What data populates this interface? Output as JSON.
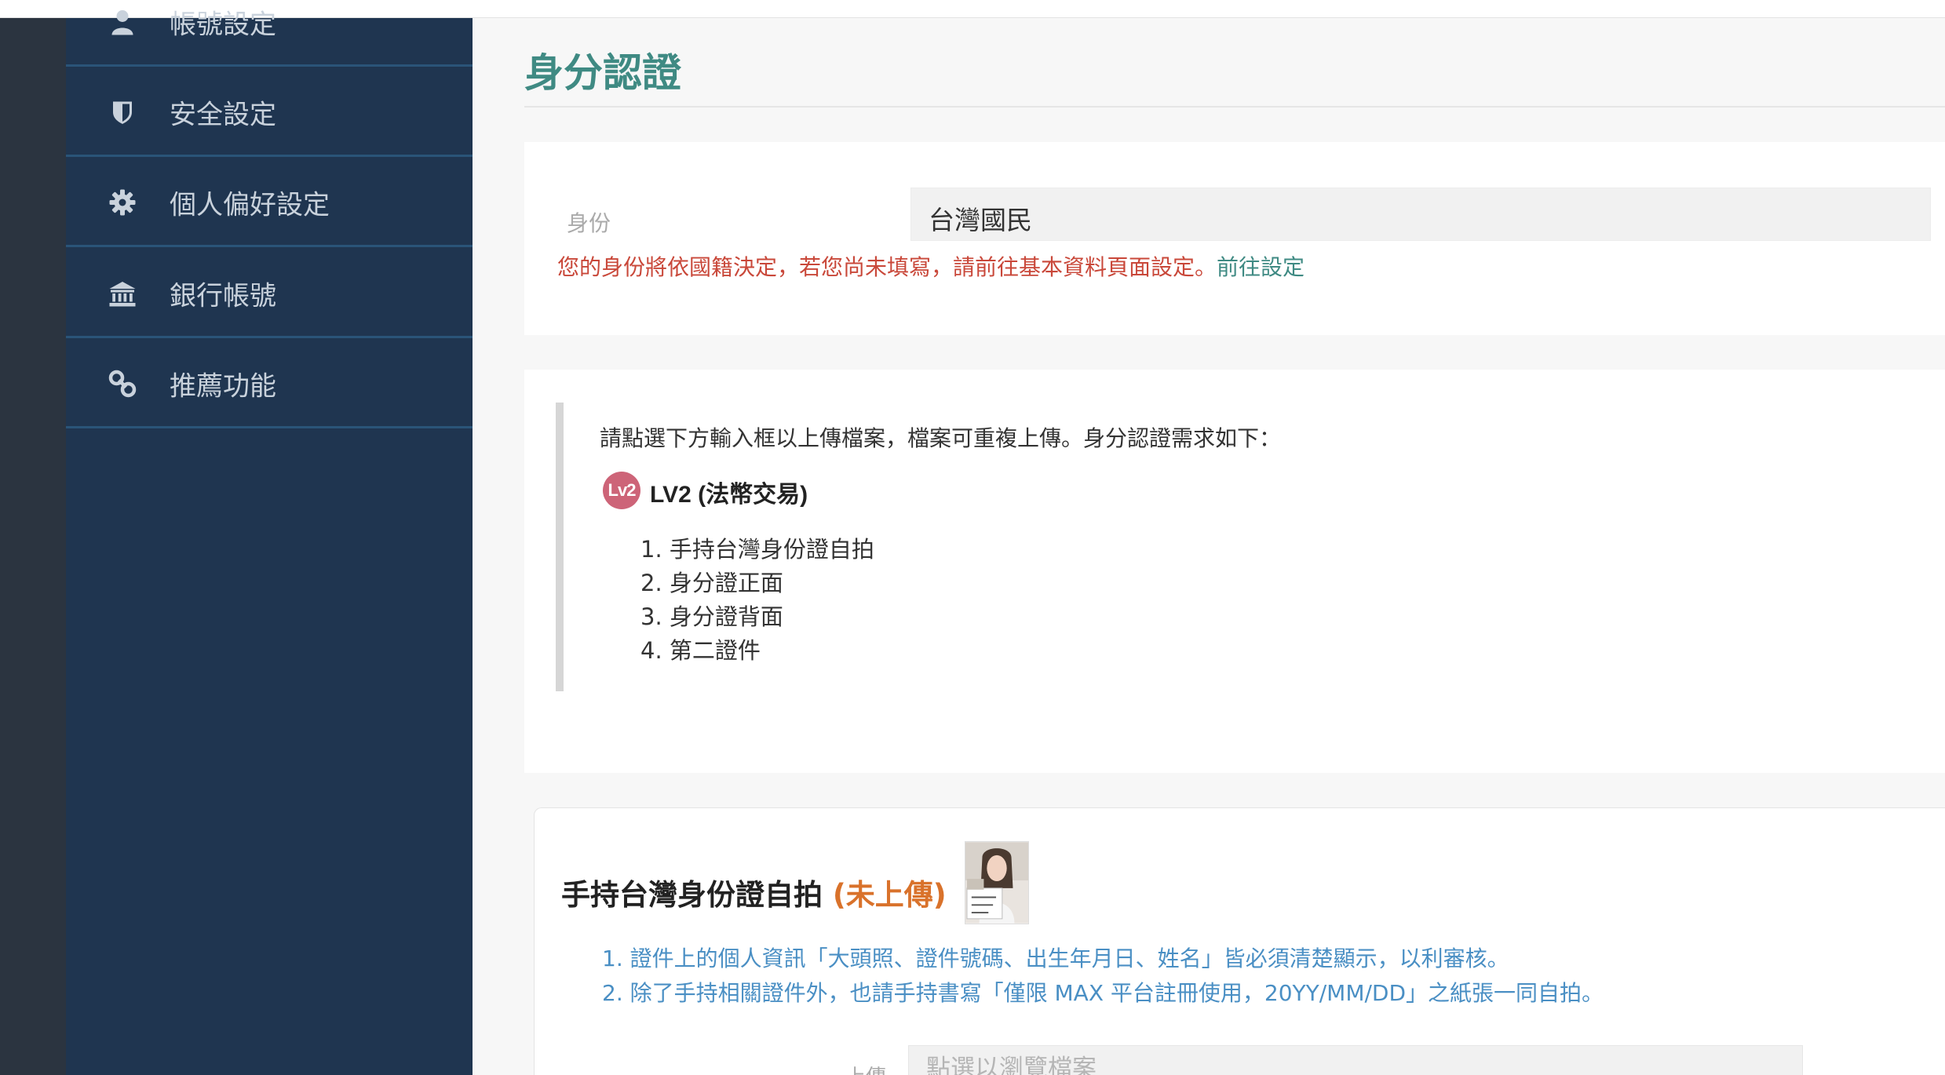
{
  "sidebar": {
    "items": [
      {
        "label": "帳號設定",
        "icon": "user-icon"
      },
      {
        "label": "安全設定",
        "icon": "shield-icon"
      },
      {
        "label": "個人偏好設定",
        "icon": "gear-icon"
      },
      {
        "label": "銀行帳號",
        "icon": "bank-icon"
      },
      {
        "label": "推薦功能",
        "icon": "link-icon"
      }
    ]
  },
  "main": {
    "title": "身分認證",
    "identity": {
      "label": "身份",
      "value": "台灣國民",
      "hint": "您的身份將依國籍決定，若您尚未填寫，請前往基本資料頁面設定。",
      "hint_link": "前往設定"
    },
    "requirements": {
      "intro": "請點選下方輸入框以上傳檔案，檔案可重複上傳。身分認證需求如下：",
      "level_badge": "Lv2",
      "level_title": "LV2 (法幣交易)",
      "items": [
        "1. 手持台灣身份證自拍",
        "2. 身分證正面",
        "3. 身分證背面",
        "4. 第二證件"
      ]
    },
    "upload": {
      "title": "手持台灣身份證自拍",
      "status": "(未上傳)",
      "notes": [
        "1. 證件上的個人資訊「大頭照、證件號碼、出生年月日、姓名」皆必須清楚顯示，以利審核。",
        "2. 除了手持相關證件外，也請手持書寫「僅限 MAX 平台註冊使用，20YY/MM/DD」之紙張一同自拍。"
      ],
      "field_label": "上傳",
      "placeholder": "點選以瀏覽檔案"
    }
  },
  "colors": {
    "sidebar_bg": "#1f3550",
    "rail_bg": "#2b3440",
    "title_teal": "#3f8a83",
    "hint_red": "#c9483a",
    "status_orange": "#d9722b",
    "note_blue": "#4a8fc4",
    "badge_pink": "#cd6478"
  }
}
